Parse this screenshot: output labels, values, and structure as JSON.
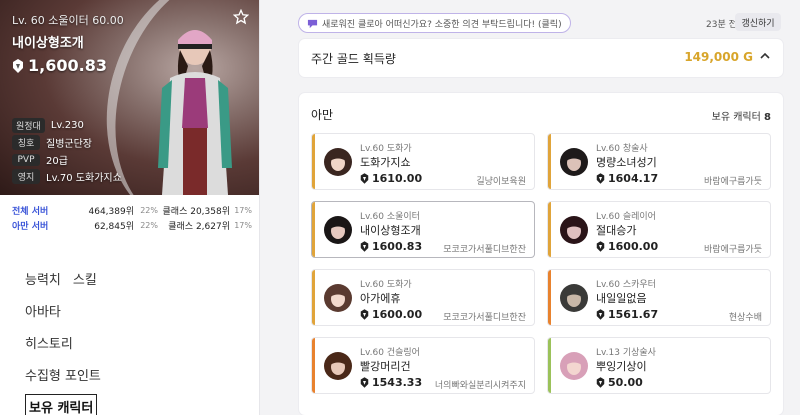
{
  "hero": {
    "level": "Lv. 60 소울이터 60.00",
    "name": "내이상형조개",
    "power": "1,600.83",
    "info": [
      {
        "tag": "원정대",
        "value": "Lv.230"
      },
      {
        "tag": "칭호",
        "value": "질병군단장"
      },
      {
        "tag": "PVP",
        "value": "20급"
      },
      {
        "tag": "영지",
        "value": "Lv.70 도화가지쇼"
      }
    ]
  },
  "server_stats": [
    {
      "label": "전체 서버",
      "rank": "464,389위",
      "pct": "22%",
      "class_rank": "클래스 20,358위",
      "class_pct": "17%"
    },
    {
      "label": "아만 서버",
      "rank": "62,845위",
      "pct": "22%",
      "class_rank": "클래스 2,627위",
      "class_pct": "17%"
    }
  ],
  "menu": {
    "stats": "능력치",
    "skills": "스킬",
    "avatar": "아바타",
    "history": "히스토리",
    "collectibles": "수집형 포인트",
    "characters": "보유 캐릭터"
  },
  "notice": "새로워진 클로아 어떠신가요? 소중한 의견 부탁드립니다! (클릭)",
  "time_ago": "23분 전",
  "refresh_label": "갱신하기",
  "gold": {
    "title": "주간 골드 획득량",
    "value": "149,000 G"
  },
  "roster": {
    "server": "아만",
    "owned_label": "보유 캐릭터",
    "owned_count": "8",
    "characters": [
      {
        "cls": "Lv.60 도화가",
        "name": "도화가지쇼",
        "power": "1610.00",
        "guild": "길냥이보육원",
        "color": "#e0a43a"
      },
      {
        "cls": "Lv.60 창술사",
        "name": "명량소녀성기",
        "power": "1604.17",
        "guild": "바람에구름가듯",
        "color": "#e0a43a"
      },
      {
        "cls": "Lv.60 소울이터",
        "name": "내이상형조개",
        "power": "1600.83",
        "guild": "모코코가서풀디브한잔",
        "color": "#e0a43a"
      },
      {
        "cls": "Lv.60 슬레이어",
        "name": "절대승가",
        "power": "1600.00",
        "guild": "바람에구름가듯",
        "color": "#e0a43a"
      },
      {
        "cls": "Lv.60 도화가",
        "name": "아가에휴",
        "power": "1600.00",
        "guild": "모코코가서풀디브한잔",
        "color": "#e0a43a"
      },
      {
        "cls": "Lv.60 스카우터",
        "name": "내일일없음",
        "power": "1561.67",
        "guild": "현상수배",
        "color": "#e8822e"
      },
      {
        "cls": "Lv.60 건슬링어",
        "name": "빨강머리건",
        "power": "1543.33",
        "guild": "너의빠와실분리시켜주지",
        "color": "#e8822e"
      },
      {
        "cls": "Lv.13 기상술사",
        "name": "뿌잉기상이",
        "power": "50.00",
        "guild": "",
        "color": "#9bc25a"
      }
    ]
  }
}
